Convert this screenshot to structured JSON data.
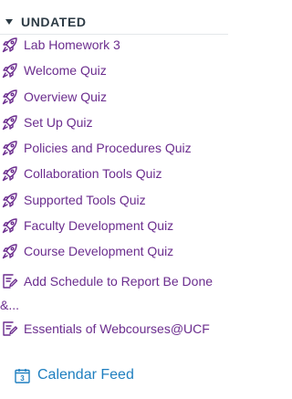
{
  "section": {
    "title": "UNDATED"
  },
  "items": [
    {
      "label": "Lab Homework 3",
      "icon": "rocket-icon"
    },
    {
      "label": "Welcome Quiz",
      "icon": "rocket-icon"
    },
    {
      "label": "Overview Quiz",
      "icon": "rocket-icon"
    },
    {
      "label": "Set Up Quiz",
      "icon": "rocket-icon"
    },
    {
      "label": "Policies and Procedures Quiz",
      "icon": "rocket-icon"
    },
    {
      "label": "Collaboration Tools Quiz",
      "icon": "rocket-icon"
    },
    {
      "label": "Supported Tools Quiz",
      "icon": "rocket-icon"
    },
    {
      "label": "Faculty Development Quiz",
      "icon": "rocket-icon"
    },
    {
      "label": "Course Development Quiz",
      "icon": "rocket-icon"
    },
    {
      "label": "Add Schedule to Report Be Done &...",
      "icon": "assignment-edit-icon"
    },
    {
      "label": "Essentials of Webcourses@UCF",
      "icon": "assignment-edit-icon"
    }
  ],
  "calendar_feed": {
    "label": "Calendar Feed",
    "icon": "calendar-icon",
    "icon_text": "3"
  },
  "colors": {
    "item_text": "#6b2d8e",
    "link": "#1f7fc0",
    "header": "#2d3b45"
  }
}
